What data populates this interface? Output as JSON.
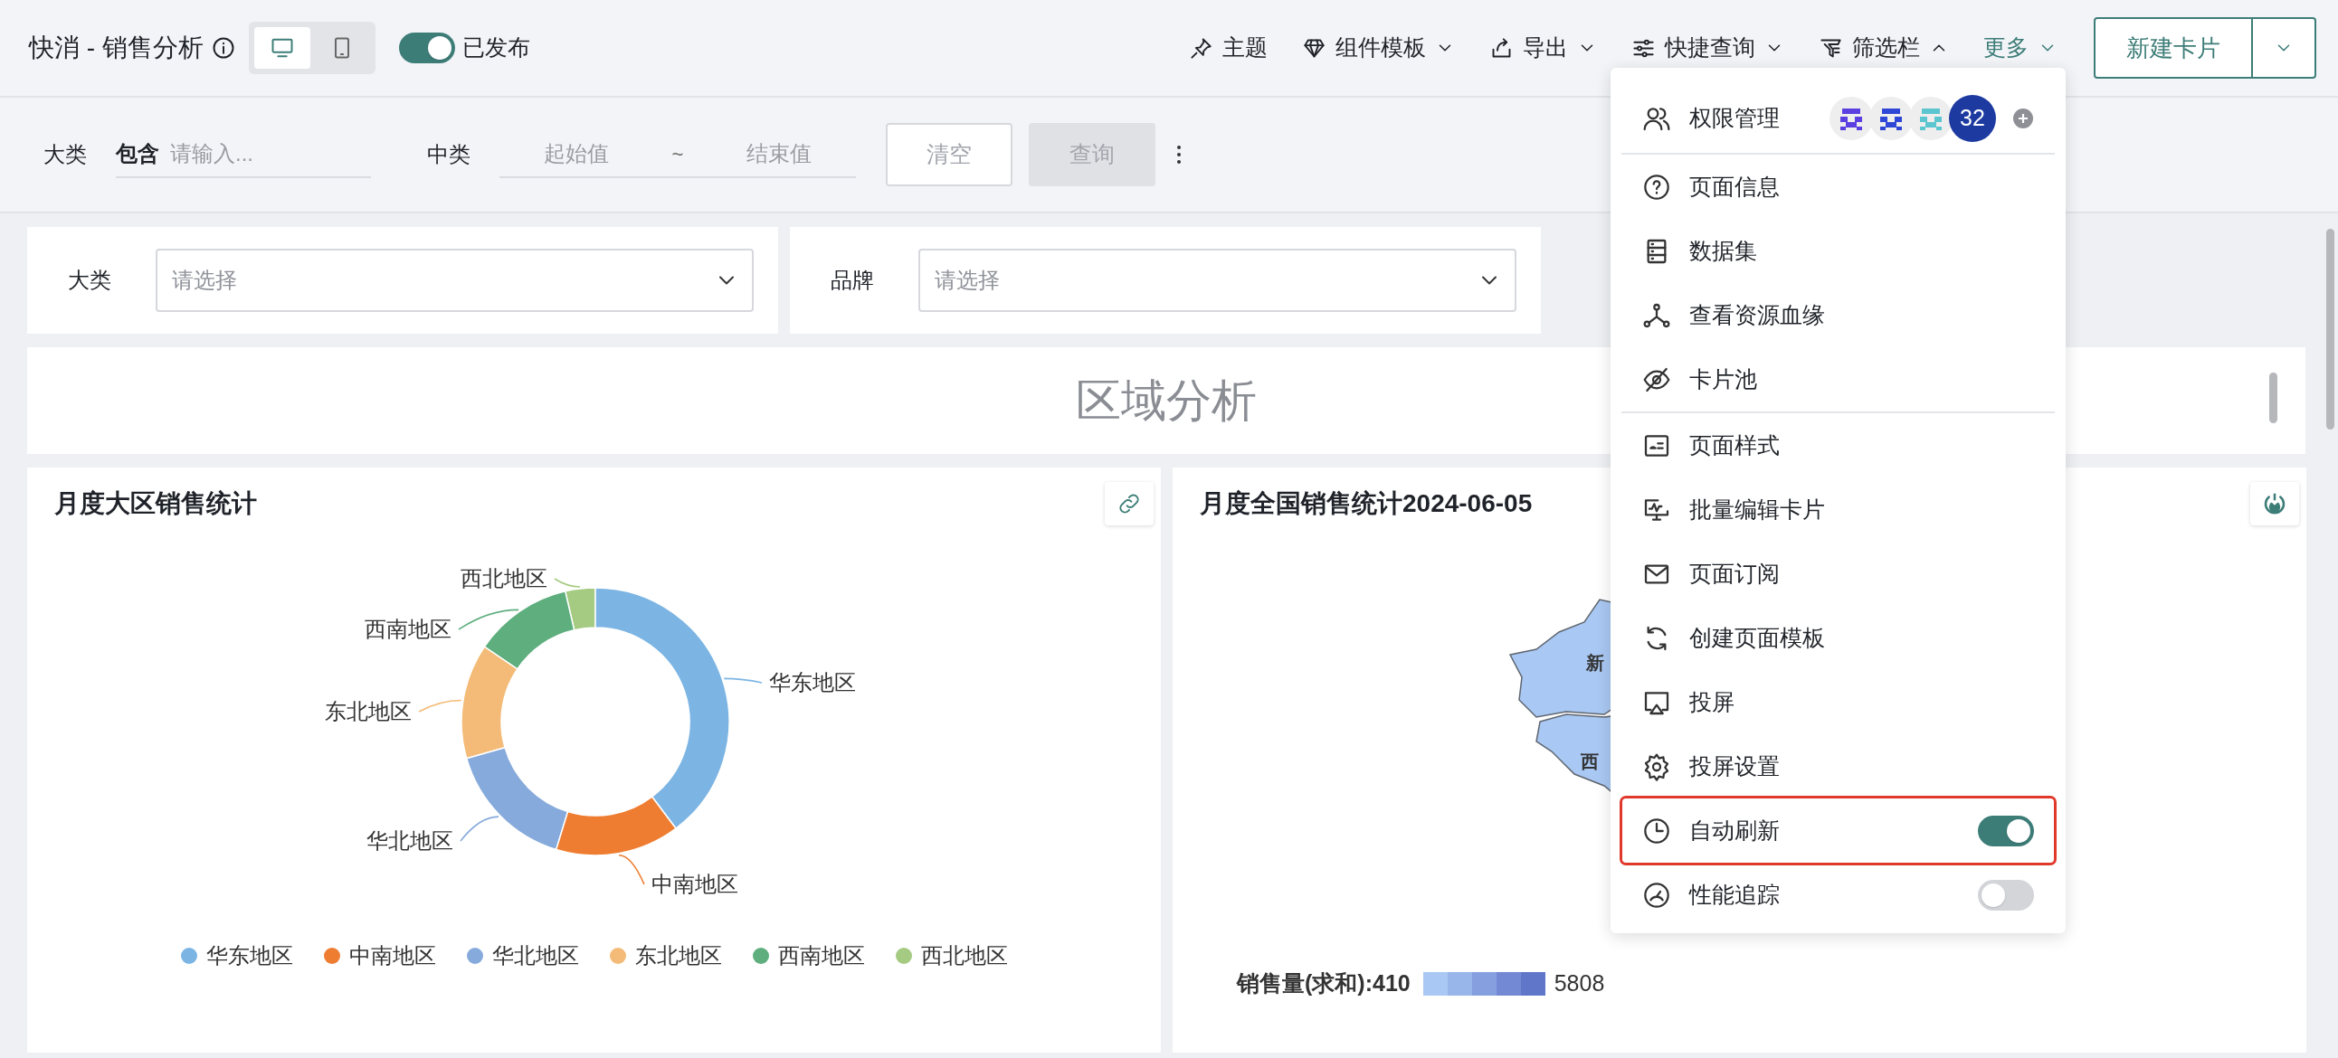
{
  "header": {
    "title": "快消 - 销售分析",
    "view_modes": [
      {
        "kind": "desktop",
        "selected": true
      },
      {
        "kind": "mobile",
        "selected": false
      }
    ],
    "publish": {
      "on": true,
      "label": "已发布"
    },
    "toolbar": [
      {
        "kind": "button",
        "label": "主题",
        "selected": false
      },
      {
        "kind": "dropdown",
        "label": "组件模板",
        "expanded": false,
        "selected": false
      },
      {
        "kind": "dropdown",
        "label": "导出",
        "expanded": false,
        "selected": false
      },
      {
        "kind": "dropdown",
        "label": "快捷查询",
        "expanded": false,
        "selected": false
      },
      {
        "kind": "dropdown",
        "label": "筛选栏",
        "expanded": true,
        "selected": false
      },
      {
        "kind": "dropdown",
        "label": "更多",
        "expanded": false,
        "selected": true
      }
    ],
    "new_card_button": "新建卡片"
  },
  "filter_bar": {
    "fields": [
      {
        "kind": "text",
        "label": "大类",
        "operator": "包含",
        "placeholder": "请输入..."
      },
      {
        "kind": "range",
        "label": "中类",
        "start_placeholder": "起始值",
        "separator": "~",
        "end_placeholder": "结束值"
      }
    ],
    "buttons": [
      {
        "label": "清空",
        "kind": "outline",
        "disabled": true
      },
      {
        "label": "查询",
        "kind": "filled",
        "disabled": true
      }
    ]
  },
  "filter_cards": [
    {
      "label": "大类",
      "placeholder": "请选择"
    },
    {
      "label": "品牌",
      "placeholder": "请选择"
    }
  ],
  "section_title": "区域分析",
  "region_chart": {
    "title": "月度大区销售统计",
    "slices": [
      {
        "label": "西北地区",
        "color": "#a5cb82"
      },
      {
        "label": "西南地区",
        "color": "#5eae7e"
      },
      {
        "label": "华东地区",
        "color": "#7cb5e3"
      },
      {
        "label": "东北地区",
        "color": "#f3bb77"
      },
      {
        "label": "华北地区",
        "color": "#86aadb"
      },
      {
        "label": "中南地区",
        "color": "#ee7d31"
      }
    ],
    "legend": [
      {
        "label": "华东地区",
        "color": "#7cb5e3"
      },
      {
        "label": "中南地区",
        "color": "#ee7d31"
      },
      {
        "label": "华北地区",
        "color": "#86aadb"
      },
      {
        "label": "东北地区",
        "color": "#f3bb77"
      },
      {
        "label": "西南地区",
        "color": "#5eae7e"
      },
      {
        "label": "西北地区",
        "color": "#a5cb82"
      }
    ]
  },
  "map_chart": {
    "title": "月度全国销售统计2024-06-05",
    "region_labels": [
      "新",
      "西"
    ],
    "legend": {
      "min_label": "销售量(求和):410",
      "max_label": "5808"
    }
  },
  "menu": {
    "owner_row": {
      "label": "权限管理",
      "avatars": [
        {
          "color": "#5b3fe0"
        },
        {
          "color": "#2f47d6"
        },
        {
          "color": "#5cc6d0"
        }
      ],
      "count": "32"
    },
    "groups": [
      [
        {
          "kind": "action",
          "label": "页面信息",
          "highlighted": false
        },
        {
          "kind": "action",
          "label": "数据集",
          "highlighted": false
        },
        {
          "kind": "action",
          "label": "查看资源血缘",
          "highlighted": false
        },
        {
          "kind": "action",
          "label": "卡片池",
          "highlighted": false
        }
      ],
      [
        {
          "kind": "action",
          "label": "页面样式",
          "highlighted": false
        },
        {
          "kind": "action",
          "label": "批量编辑卡片",
          "highlighted": false
        },
        {
          "kind": "action",
          "label": "页面订阅",
          "highlighted": false
        },
        {
          "kind": "action",
          "label": "创建页面模板",
          "highlighted": false
        },
        {
          "kind": "action",
          "label": "投屏",
          "highlighted": false
        },
        {
          "kind": "action",
          "label": "投屏设置",
          "highlighted": false
        },
        {
          "kind": "toggle",
          "label": "自动刷新",
          "on": true,
          "highlighted": true
        },
        {
          "kind": "toggle",
          "label": "性能追踪",
          "on": false,
          "highlighted": false
        }
      ]
    ]
  }
}
